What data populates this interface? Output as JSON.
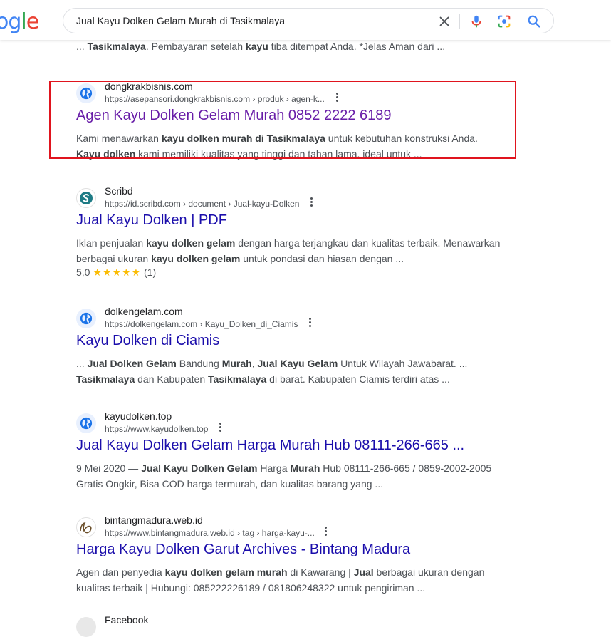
{
  "header": {
    "logo_letters": [
      "o",
      "g",
      "l",
      "e"
    ],
    "search_query": "Jual Kayu Dolken Gelam Murah di Tasikmalaya"
  },
  "top_snippet": {
    "parts": [
      "... ",
      "Tasikmalaya",
      ". Pembayaran setelah ",
      "kayu",
      " tiba ditempat Anda. *Jelas Aman dari ..."
    ]
  },
  "results": [
    {
      "site_name": "dongkrakbisnis.com",
      "url": "https://asepansori.dongkrakbisnis.com › produk › agen-k...",
      "title": "Agen Kayu Dolken Gelam Murah 0852 2222 6189",
      "line1": [
        "Kami menawarkan ",
        "kayu dolken murah di Tasikmalaya",
        " untuk kebutuhan konstruksi Anda."
      ],
      "line2": [
        "Kayu dolken",
        " kami memiliki kualitas yang tinggi dan tahan lama, ideal untuk ..."
      ]
    },
    {
      "site_name": "Scribd",
      "url": "https://id.scribd.com › document › Jual-kayu-Dolken",
      "title": "Jual Kayu Dolken | PDF",
      "line1": [
        "Iklan penjualan ",
        "kayu dolken gelam",
        " dengan harga terjangkau dan kualitas terbaik. Menawarkan"
      ],
      "line2": [
        "berbagai ukuran ",
        "kayu dolken gelam",
        " untuk pondasi dan hiasan dengan ..."
      ],
      "rating_value": "5,0",
      "rating_stars": "★★★★★",
      "rating_count": "(1)"
    },
    {
      "site_name": "dolkengelam.com",
      "url": "https://dolkengelam.com › Kayu_Dolken_di_Ciamis",
      "title": "Kayu Dolken di Ciamis",
      "line1": [
        "... ",
        "Jual Dolken Gelam",
        " Bandung ",
        "Murah",
        ", ",
        "Jual Kayu Gelam",
        " Untuk Wilayah Jawabarat. ..."
      ],
      "line2": [
        "Tasikmalaya",
        " dan Kabupaten ",
        "Tasikmalaya",
        " di barat. Kabupaten Ciamis terdiri atas ..."
      ]
    },
    {
      "site_name": "kayudolken.top",
      "url": "https://www.kayudolken.top",
      "title": "Jual Kayu Dolken Gelam Harga Murah Hub 08111-266-665 ...",
      "line1": [
        "9 Mei 2020 — ",
        "Jual Kayu Dolken Gelam",
        " Harga ",
        "Murah",
        " Hub 08111-266-665 / 0859-2002-2005"
      ],
      "line2": [
        "Gratis Ongkir, Bisa COD harga termurah, dan kualitas barang yang ..."
      ]
    },
    {
      "site_name": "bintangmadura.web.id",
      "url": "https://www.bintangmadura.web.id › tag › harga-kayu-...",
      "title": "Harga Kayu Dolken Garut Archives - Bintang Madura",
      "line1": [
        "Agen dan penyedia ",
        "kayu dolken gelam murah",
        " di Kawarang | ",
        "Jual",
        " berbagai ukuran dengan"
      ],
      "line2": [
        "kualitas terbaik | Hubungi: 085222226189 / 081806248322 untuk pengiriman ..."
      ]
    }
  ],
  "partial_result": {
    "site_name": "Facebook"
  },
  "colors": {
    "link": "#1a0dab",
    "visited_link": "#681da8",
    "highlight_border": "#e0141e",
    "star": "#fbbc04"
  }
}
